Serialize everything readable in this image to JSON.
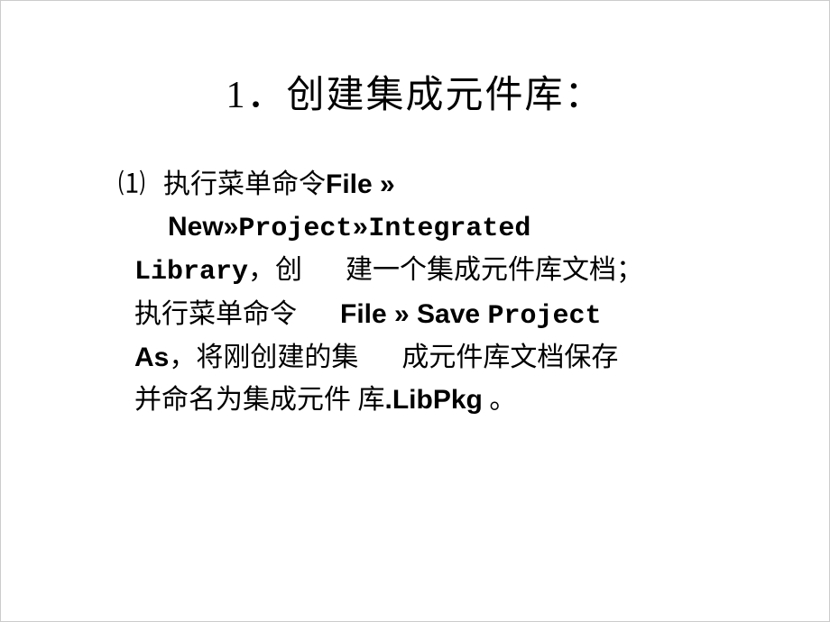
{
  "slide": {
    "title": "1．创建集成元件库：",
    "item_marker": "⑴",
    "line1_pre": "执行菜单命令",
    "line1_bold": "File »",
    "line2_bold_sans": "New»",
    "line2_bold_mono": "Project»Integrated",
    "line3_bold_mono": "Library",
    "line3_mid1": "，创",
    "line3_mid2": "建一个集成元件库文档；",
    "line4_pre": "执行菜单命令",
    "line4_bold_sans": "File » Save ",
    "line4_bold_mono": "Project",
    "line5_bold_sans": "As",
    "line5_mid1": "，将刚创建的集",
    "line5_mid2": "成元件库文档保存",
    "line6_pre": "并命名为集成元件 库",
    "line6_bold": ".LibPkg",
    "line6_end": " 。"
  }
}
